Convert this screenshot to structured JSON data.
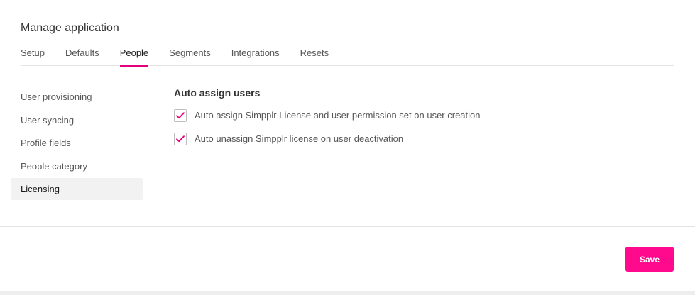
{
  "app": {
    "title": "Manage application"
  },
  "tabs": [
    {
      "label": "Setup"
    },
    {
      "label": "Defaults"
    },
    {
      "label": "People",
      "active": true
    },
    {
      "label": "Segments"
    },
    {
      "label": "Integrations"
    },
    {
      "label": "Resets"
    }
  ],
  "sidebar": {
    "items": [
      {
        "label": "User provisioning"
      },
      {
        "label": "User syncing"
      },
      {
        "label": "Profile fields"
      },
      {
        "label": "People category"
      },
      {
        "label": "Licensing",
        "active": true
      }
    ]
  },
  "content": {
    "section_title": "Auto assign users",
    "options": [
      {
        "label": "Auto assign Simpplr License and user permission set on user creation",
        "checked": true
      },
      {
        "label": "Auto unassign Simpplr license on user deactivation",
        "checked": true
      }
    ]
  },
  "footer": {
    "save_label": "Save"
  },
  "colors": {
    "accent": "#e4007c",
    "button": "#ff0a8c"
  },
  "icons": {
    "checkbox_checked": "check-icon"
  }
}
